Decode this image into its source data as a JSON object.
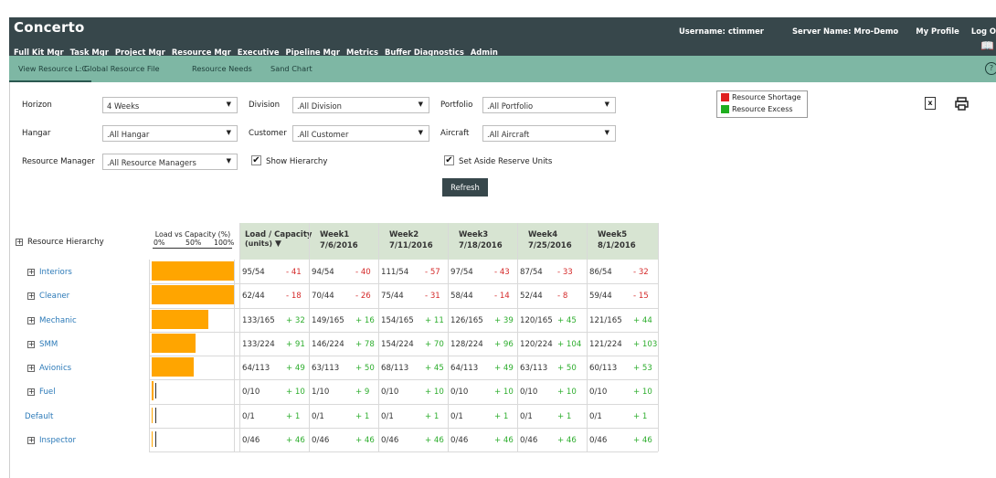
{
  "app": {
    "title": "Concerto"
  },
  "nav": [
    "Full Kit Mgr",
    "Task Mgr",
    "Project Mgr",
    "Resource Mgr",
    "Executive",
    "Pipeline Mgr",
    "Metrics",
    "Buffer Diagnostics",
    "Admin"
  ],
  "nav_active": "Resource Mgr",
  "user": {
    "username": "Username: ctimmer",
    "server": "Server Name: Mro-Demo",
    "profile": "My Profile",
    "logout": "Log O"
  },
  "subnav": [
    "View Resource L:C",
    "Global Resource File",
    "Resource Needs",
    "Sand Chart"
  ],
  "filters": {
    "horizon_label": "Horizon",
    "horizon_value": "4 Weeks",
    "division_label": "Division",
    "division_value": ".All Division",
    "portfolio_label": "Portfolio",
    "portfolio_value": ".All Portfolio",
    "hangar_label": "Hangar",
    "hangar_value": ".All Hangar",
    "customer_label": "Customer",
    "customer_value": ".All Customer",
    "aircraft_label": "Aircraft",
    "aircraft_value": ".All Aircraft",
    "manager_label": "Resource Manager",
    "manager_value": ".All Resource Managers",
    "show_hierarchy": "Show Hierarchy",
    "set_aside": "Set Aside Reserve Units",
    "refresh": "Refresh"
  },
  "legend": {
    "shortage": "Resource Shortage",
    "excess": "Resource Excess",
    "shortage_color": "#e02020",
    "excess_color": "#1fae1f"
  },
  "table": {
    "hierarchy_label": "Resource Hierarchy",
    "lvc_label": "Load vs Capacity (%)",
    "lvc_ticks": [
      "0%",
      "50%",
      "100%"
    ],
    "lc_header": "Load / Capacity",
    "lc_units": "(units)",
    "weeks": [
      {
        "name": "Week1",
        "date": "7/6/2016"
      },
      {
        "name": "Week2",
        "date": "7/11/2016"
      },
      {
        "name": "Week3",
        "date": "7/18/2016"
      },
      {
        "name": "Week4",
        "date": "7/25/2016"
      },
      {
        "name": "Week5",
        "date": "8/1/2016"
      }
    ],
    "rows": [
      {
        "name": "Interiors",
        "expand": true,
        "load_pct": 100,
        "cells": [
          [
            "95/54",
            "- 41"
          ],
          [
            "94/54",
            "- 40"
          ],
          [
            "111/54",
            "- 57"
          ],
          [
            "97/54",
            "- 43"
          ],
          [
            "87/54",
            "- 33"
          ],
          [
            "86/54",
            "- 32"
          ]
        ]
      },
      {
        "name": "Cleaner",
        "expand": true,
        "load_pct": 100,
        "cells": [
          [
            "62/44",
            "- 18"
          ],
          [
            "70/44",
            "- 26"
          ],
          [
            "75/44",
            "- 31"
          ],
          [
            "58/44",
            "- 14"
          ],
          [
            "52/44",
            "- 8"
          ],
          [
            "59/44",
            "- 15"
          ]
        ]
      },
      {
        "name": "Mechanic",
        "expand": true,
        "load_pct": 69,
        "cells": [
          [
            "133/165",
            "+ 32"
          ],
          [
            "149/165",
            "+ 16"
          ],
          [
            "154/165",
            "+ 11"
          ],
          [
            "126/165",
            "+ 39"
          ],
          [
            "120/165",
            "+ 45"
          ],
          [
            "121/165",
            "+ 44"
          ]
        ]
      },
      {
        "name": "SMM",
        "expand": true,
        "load_pct": 53,
        "cells": [
          [
            "133/224",
            "+ 91"
          ],
          [
            "146/224",
            "+ 78"
          ],
          [
            "154/224",
            "+ 70"
          ],
          [
            "128/224",
            "+ 96"
          ],
          [
            "120/224",
            "+ 104"
          ],
          [
            "121/224",
            "+ 103"
          ]
        ]
      },
      {
        "name": "Avionics",
        "expand": true,
        "load_pct": 51,
        "cells": [
          [
            "64/113",
            "+ 49"
          ],
          [
            "63/113",
            "+ 50"
          ],
          [
            "68/113",
            "+ 45"
          ],
          [
            "64/113",
            "+ 49"
          ],
          [
            "63/113",
            "+ 50"
          ],
          [
            "60/113",
            "+ 53"
          ]
        ]
      },
      {
        "name": "Fuel",
        "expand": true,
        "load_pct": 2,
        "cells": [
          [
            "0/10",
            "+ 10"
          ],
          [
            "1/10",
            "+ 9"
          ],
          [
            "0/10",
            "+ 10"
          ],
          [
            "0/10",
            "+ 10"
          ],
          [
            "0/10",
            "+ 10"
          ],
          [
            "0/10",
            "+ 10"
          ]
        ]
      },
      {
        "name": "Default",
        "expand": false,
        "load_pct": 0,
        "cells": [
          [
            "0/1",
            "+ 1"
          ],
          [
            "0/1",
            "+ 1"
          ],
          [
            "0/1",
            "+ 1"
          ],
          [
            "0/1",
            "+ 1"
          ],
          [
            "0/1",
            "+ 1"
          ],
          [
            "0/1",
            "+ 1"
          ]
        ]
      },
      {
        "name": "Inspector",
        "expand": true,
        "load_pct": 0,
        "cells": [
          [
            "0/46",
            "+ 46"
          ],
          [
            "0/46",
            "+ 46"
          ],
          [
            "0/46",
            "+ 46"
          ],
          [
            "0/46",
            "+ 46"
          ],
          [
            "0/46",
            "+ 46"
          ],
          [
            "0/46",
            "+ 46"
          ]
        ]
      }
    ]
  },
  "icons": {
    "export": "excel-export-icon",
    "print": "print-icon",
    "docs": "book-icon",
    "help": "help-icon"
  }
}
